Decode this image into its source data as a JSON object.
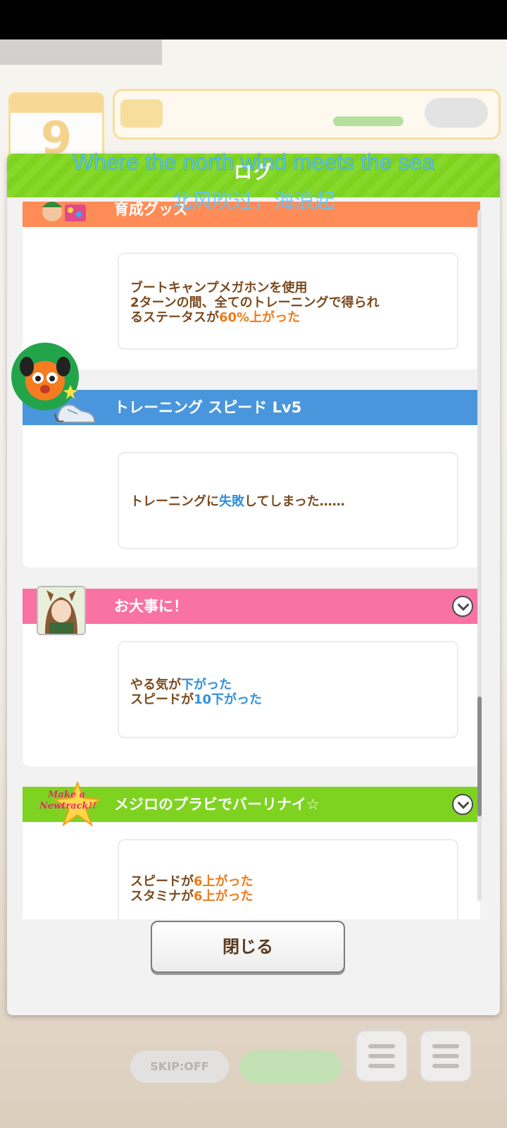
{
  "dialog": {
    "title": "ログ",
    "close_label": "閉じる"
  },
  "subtitles": {
    "english": "Where the north wind meets the sea",
    "chinese": "北风吹过，海浪起"
  },
  "log_entries": [
    {
      "title": "育成グッズ",
      "bar_color": "#ff8c57",
      "line1": "ブートキャンプメガホンを使用",
      "line2": "2ターンの間、全てのトレーニングで得られ",
      "line3_prefix": "るステータスが",
      "line3_highlight": "60%上がった",
      "thumbnail": "shop-items-icon"
    },
    {
      "title": "トレーニング スピード Lv5",
      "bar_color": "#4a96dc",
      "line1_prefix": "トレーニングに",
      "line1_highlight": "失敗",
      "line1_suffix": "してしまった……",
      "thumbnail": "running-shoe-icon"
    },
    {
      "title": "お大事に！",
      "bar_color": "#f872a2",
      "line1_prefix": "やる気が",
      "line1_highlight": "下がった",
      "line2_prefix": "スピードが",
      "line2_highlight": "10下がった",
      "thumbnail": "character-portrait"
    },
    {
      "title": "メジロのプラビでバーリナイ☆",
      "bar_color": "#7ed321",
      "line1_prefix": "スピードが",
      "line1_highlight": "6上がった",
      "line2_prefix": "スタミナが",
      "line2_highlight": "6上がった",
      "thumbnail": "make-a-new-track-logo",
      "logo_text_1": "Make a",
      "logo_text_2": "Newtrack!!"
    }
  ],
  "background": {
    "calendar_day": "9",
    "skip_label": "SKIP:OFF"
  },
  "colors": {
    "header_green": "#7ed321",
    "text_brown": "#7a4a1e",
    "highlight_orange": "#f07a1a",
    "highlight_blue": "#2f8fde"
  }
}
